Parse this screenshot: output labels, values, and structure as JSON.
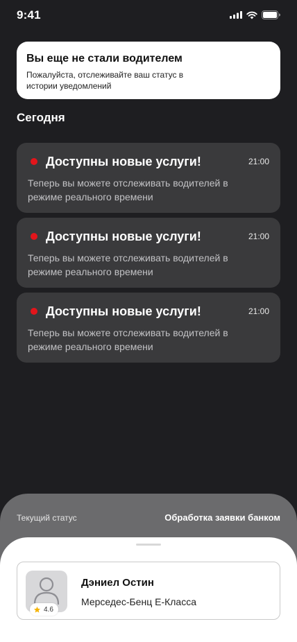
{
  "status_bar": {
    "time": "9:41"
  },
  "banner": {
    "title": "Вы еще не стали водителем",
    "text": "Пожалуйста, отслеживайте ваш статус в истории уведомлений"
  },
  "section": {
    "title": "Сегодня"
  },
  "notifications": [
    {
      "title": "Доступны новые услуги!",
      "time": "21:00",
      "body": "Теперь вы можете отслеживать водителей в режиме реального времени"
    },
    {
      "title": "Доступны новые услуги!",
      "time": "21:00",
      "body": "Теперь вы можете отслеживать водителей в режиме реального времени"
    },
    {
      "title": "Доступны новые услуги!",
      "time": "21:00",
      "body": "Теперь вы можете отслеживать водителей в режиме реального времени"
    }
  ],
  "status_panel": {
    "label": "Текущий статус",
    "value": "Обработка заявки банком"
  },
  "driver": {
    "name": "Дэниел Остин",
    "car": "Мерседес-Бенц E-Класса",
    "rating": "4.6"
  },
  "colors": {
    "background": "#1e1e21",
    "card": "#3a3a3c",
    "unread_dot": "#e3151b",
    "star": "#f5b301",
    "panel": "#6b6b6d"
  }
}
